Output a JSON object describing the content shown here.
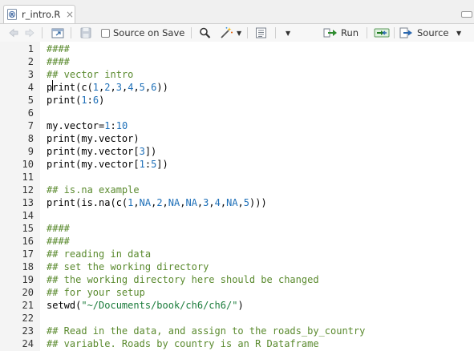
{
  "tab": {
    "filename": "r_intro.R",
    "close_glyph": "×"
  },
  "toolbar": {
    "source_on_save_label": "Source on Save",
    "run_label": "Run",
    "source_label": "Source"
  },
  "colors": {
    "comment": "#5a8a2e",
    "number": "#1d6fb8",
    "string": "#1a7b3a",
    "gutter": "#f4f4f4"
  },
  "editor": {
    "lines": [
      {
        "n": "1",
        "tokens": [
          {
            "t": "####",
            "k": "com"
          }
        ]
      },
      {
        "n": "2",
        "tokens": [
          {
            "t": "####",
            "k": "com"
          }
        ]
      },
      {
        "n": "3",
        "tokens": [
          {
            "t": "## vector intro",
            "k": "com"
          }
        ]
      },
      {
        "n": "4",
        "tokens": [
          {
            "t": "print(c(",
            "k": "plain"
          },
          {
            "t": "1",
            "k": "num"
          },
          {
            "t": ",",
            "k": "plain"
          },
          {
            "t": "2",
            "k": "num"
          },
          {
            "t": ",",
            "k": "plain"
          },
          {
            "t": "3",
            "k": "num"
          },
          {
            "t": ",",
            "k": "plain"
          },
          {
            "t": "4",
            "k": "num"
          },
          {
            "t": ",",
            "k": "plain"
          },
          {
            "t": "5",
            "k": "num"
          },
          {
            "t": ",",
            "k": "plain"
          },
          {
            "t": "6",
            "k": "num"
          },
          {
            "t": "))",
            "k": "plain"
          }
        ]
      },
      {
        "n": "5",
        "tokens": [
          {
            "t": "print(",
            "k": "plain"
          },
          {
            "t": "1",
            "k": "num"
          },
          {
            "t": ":",
            "k": "plain"
          },
          {
            "t": "6",
            "k": "num"
          },
          {
            "t": ")",
            "k": "plain"
          }
        ]
      },
      {
        "n": "6",
        "tokens": []
      },
      {
        "n": "7",
        "tokens": [
          {
            "t": "my.vector=",
            "k": "plain"
          },
          {
            "t": "1",
            "k": "num"
          },
          {
            "t": ":",
            "k": "plain"
          },
          {
            "t": "10",
            "k": "num"
          }
        ]
      },
      {
        "n": "8",
        "tokens": [
          {
            "t": "print(my.vector)",
            "k": "plain"
          }
        ]
      },
      {
        "n": "9",
        "tokens": [
          {
            "t": "print(my.vector[",
            "k": "plain"
          },
          {
            "t": "3",
            "k": "num"
          },
          {
            "t": "])",
            "k": "plain"
          }
        ]
      },
      {
        "n": "10",
        "tokens": [
          {
            "t": "print(my.vector[",
            "k": "plain"
          },
          {
            "t": "1",
            "k": "num"
          },
          {
            "t": ":",
            "k": "plain"
          },
          {
            "t": "5",
            "k": "num"
          },
          {
            "t": "])",
            "k": "plain"
          }
        ]
      },
      {
        "n": "11",
        "tokens": []
      },
      {
        "n": "12",
        "tokens": [
          {
            "t": "## is.na example",
            "k": "com"
          }
        ]
      },
      {
        "n": "13",
        "tokens": [
          {
            "t": "print(is.na(c(",
            "k": "plain"
          },
          {
            "t": "1",
            "k": "num"
          },
          {
            "t": ",",
            "k": "plain"
          },
          {
            "t": "NA",
            "k": "num"
          },
          {
            "t": ",",
            "k": "plain"
          },
          {
            "t": "2",
            "k": "num"
          },
          {
            "t": ",",
            "k": "plain"
          },
          {
            "t": "NA",
            "k": "num"
          },
          {
            "t": ",",
            "k": "plain"
          },
          {
            "t": "NA",
            "k": "num"
          },
          {
            "t": ",",
            "k": "plain"
          },
          {
            "t": "3",
            "k": "num"
          },
          {
            "t": ",",
            "k": "plain"
          },
          {
            "t": "4",
            "k": "num"
          },
          {
            "t": ",",
            "k": "plain"
          },
          {
            "t": "NA",
            "k": "num"
          },
          {
            "t": ",",
            "k": "plain"
          },
          {
            "t": "5",
            "k": "num"
          },
          {
            "t": ")))",
            "k": "plain"
          }
        ]
      },
      {
        "n": "14",
        "tokens": []
      },
      {
        "n": "15",
        "tokens": [
          {
            "t": "####",
            "k": "com"
          }
        ]
      },
      {
        "n": "16",
        "tokens": [
          {
            "t": "####",
            "k": "com"
          }
        ]
      },
      {
        "n": "17",
        "tokens": [
          {
            "t": "## reading in data",
            "k": "com"
          }
        ]
      },
      {
        "n": "18",
        "tokens": [
          {
            "t": "## set the working directory",
            "k": "com"
          }
        ]
      },
      {
        "n": "19",
        "tokens": [
          {
            "t": "## the working directory here should be changed",
            "k": "com"
          }
        ]
      },
      {
        "n": "20",
        "tokens": [
          {
            "t": "## for your setup",
            "k": "com"
          }
        ]
      },
      {
        "n": "21",
        "tokens": [
          {
            "t": "setwd(",
            "k": "plain"
          },
          {
            "t": "\"~/Documents/book/ch6/ch6/\"",
            "k": "str"
          },
          {
            "t": ")",
            "k": "plain"
          }
        ]
      },
      {
        "n": "22",
        "tokens": []
      },
      {
        "n": "23",
        "tokens": [
          {
            "t": "## Read in the data, and assign to the roads_by_country",
            "k": "com"
          }
        ]
      },
      {
        "n": "24",
        "tokens": [
          {
            "t": "## variable. Roads by country is an R Dataframe",
            "k": "com"
          }
        ]
      }
    ]
  }
}
